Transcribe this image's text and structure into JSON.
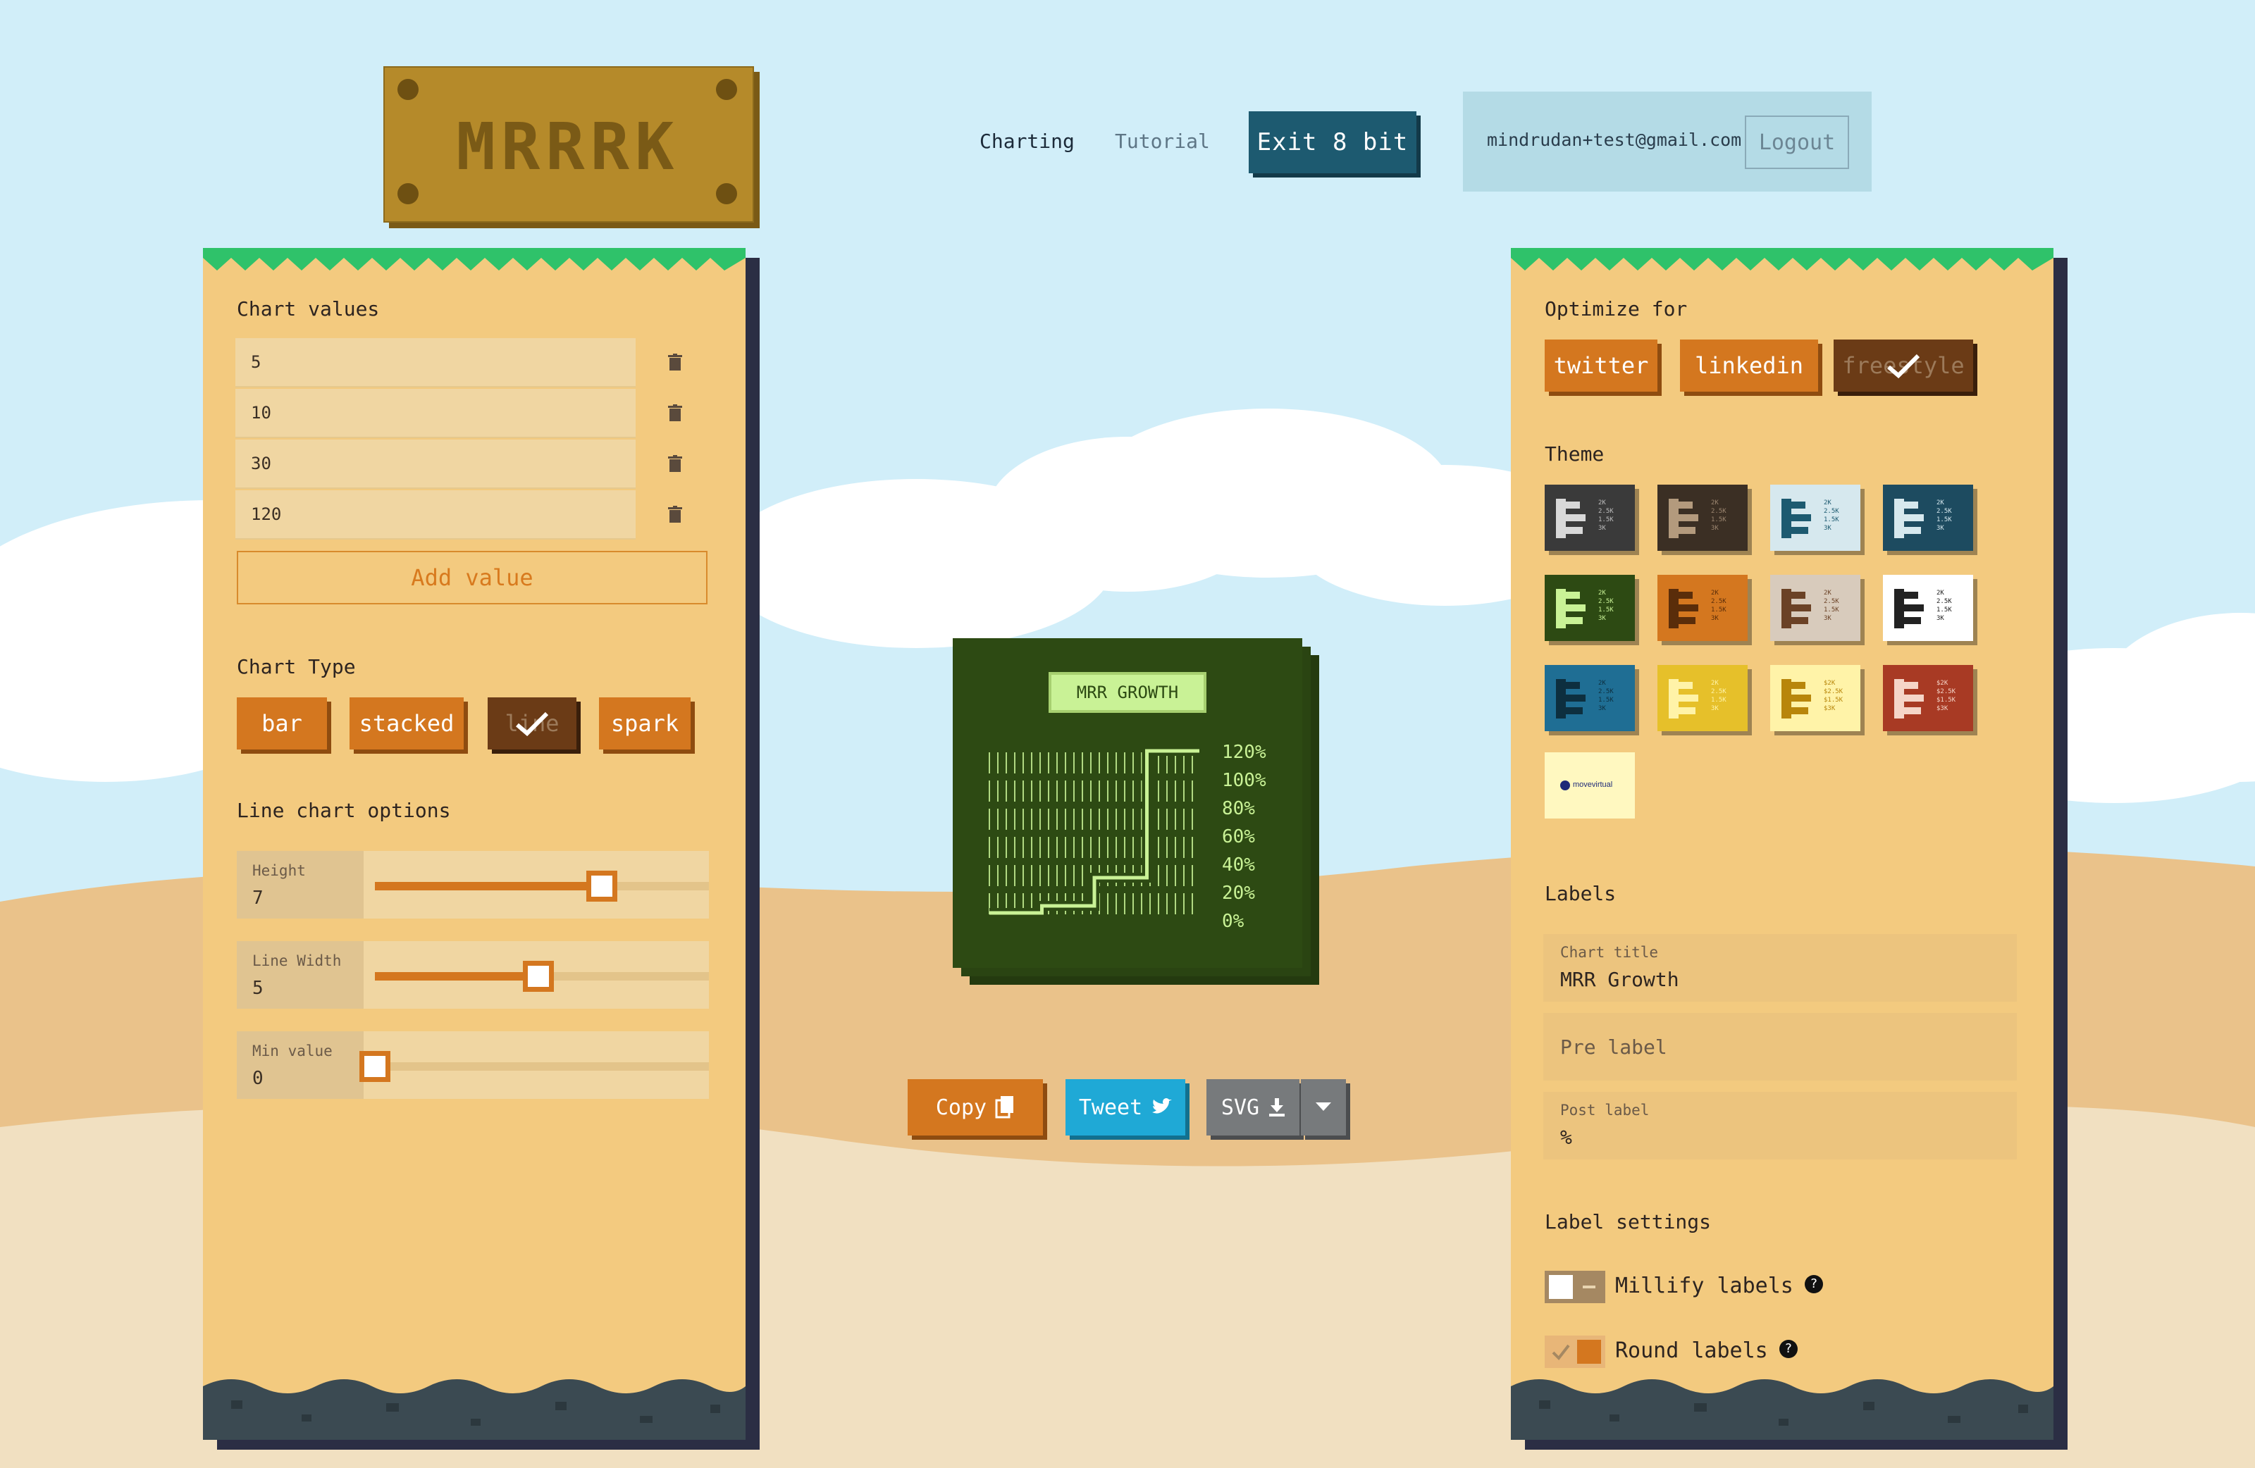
{
  "logo": {
    "text": "MRRRK"
  },
  "nav": {
    "charting": "Charting",
    "tutorial": "Tutorial",
    "exit_button": "Exit 8 bit"
  },
  "user": {
    "email": "mindrudan+test@gmail.com",
    "logout": "Logout"
  },
  "left_panel": {
    "values_title": "Chart values",
    "values": [
      "5",
      "10",
      "30",
      "120"
    ],
    "add_value": "Add value",
    "chart_type_title": "Chart Type",
    "chart_types": [
      "bar",
      "stacked",
      "line",
      "spark"
    ],
    "selected_chart_type": "line",
    "line_options_title": "Line chart options",
    "sliders": [
      {
        "label": "Height",
        "value": "7",
        "fraction": 0.68
      },
      {
        "label": "Line Width",
        "value": "5",
        "fraction": 0.49
      },
      {
        "label": "Min value",
        "value": "0",
        "fraction": 0.0
      }
    ]
  },
  "right_panel": {
    "optimize_title": "Optimize for",
    "optimize_options": [
      "twitter",
      "linkedin",
      "freestyle"
    ],
    "selected_optimize": "freestyle",
    "theme_title": "Theme",
    "themes": [
      {
        "bg": "#3a3a3a",
        "fg": "#d8d8d8",
        "text": "#bdbdbd"
      },
      {
        "bg": "#3b2f24",
        "fg": "#b39a7d",
        "text": "#9c8670"
      },
      {
        "bg": "#d6e8ee",
        "fg": "#1d5a70",
        "text": "#1d5a70"
      },
      {
        "bg": "#1d4b60",
        "fg": "#d6e8ee",
        "text": "#d6e8ee"
      },
      {
        "bg": "#2d4a13",
        "fg": "#c9f296",
        "text": "#c9f296"
      },
      {
        "bg": "#d4771f",
        "fg": "#5a2d0a",
        "text": "#5a2d0a"
      },
      {
        "bg": "#d8cbbc",
        "fg": "#6b4226",
        "text": "#6b4226"
      },
      {
        "bg": "#ffffff",
        "fg": "#222222",
        "text": "#222222"
      },
      {
        "bg": "#1f6e94",
        "fg": "#0d2f3f",
        "text": "#0d2f3f"
      },
      {
        "bg": "#e6c02a",
        "fg": "#fff3a8",
        "text": "#fff3a8"
      },
      {
        "bg": "#fff3a8",
        "fg": "#b8860b",
        "text": "#b8860b"
      },
      {
        "bg": "#a83a24",
        "fg": "#f5d5c8",
        "text": "#f5d5c8"
      }
    ],
    "theme_tile_text": [
      "2K",
      "2.5K",
      "1.5K",
      "3K"
    ],
    "theme_tile_text_dollar": [
      "$2K",
      "$2.5K",
      "$1.5K",
      "$3K"
    ],
    "custom_theme_brand": "movevirtual",
    "labels_title": "Labels",
    "chart_title_label": "Chart title",
    "chart_title_value": "MRR Growth",
    "pre_label_placeholder": "Pre label",
    "post_label_label": "Post label",
    "post_label_value": "%",
    "label_settings_title": "Label settings",
    "millify_label": "Millify labels",
    "round_label": "Round labels",
    "millify_on": false,
    "round_on": true
  },
  "chart_preview": {
    "title": "MRR GROWTH",
    "y_labels": [
      "120%",
      "100%",
      "80%",
      "60%",
      "40%",
      "20%",
      "0%"
    ]
  },
  "chart_data": {
    "type": "line",
    "title": "MRR GROWTH",
    "x": [
      1,
      2,
      3,
      4
    ],
    "values": [
      5,
      10,
      30,
      120
    ],
    "ylim": [
      0,
      120
    ],
    "y_ticks": [
      "0%",
      "20%",
      "40%",
      "60%",
      "80%",
      "100%",
      "120%"
    ]
  },
  "actions": {
    "copy": "Copy",
    "tweet": "Tweet",
    "svg": "SVG"
  },
  "colors": {
    "accent": "#d4771f",
    "panel": "#f3ca7f",
    "chart_bg": "#2d4a13",
    "chart_fg": "#c9f296",
    "tweet": "#1fa9d6",
    "svg": "#777a7c",
    "exit": "#1d5a70"
  }
}
